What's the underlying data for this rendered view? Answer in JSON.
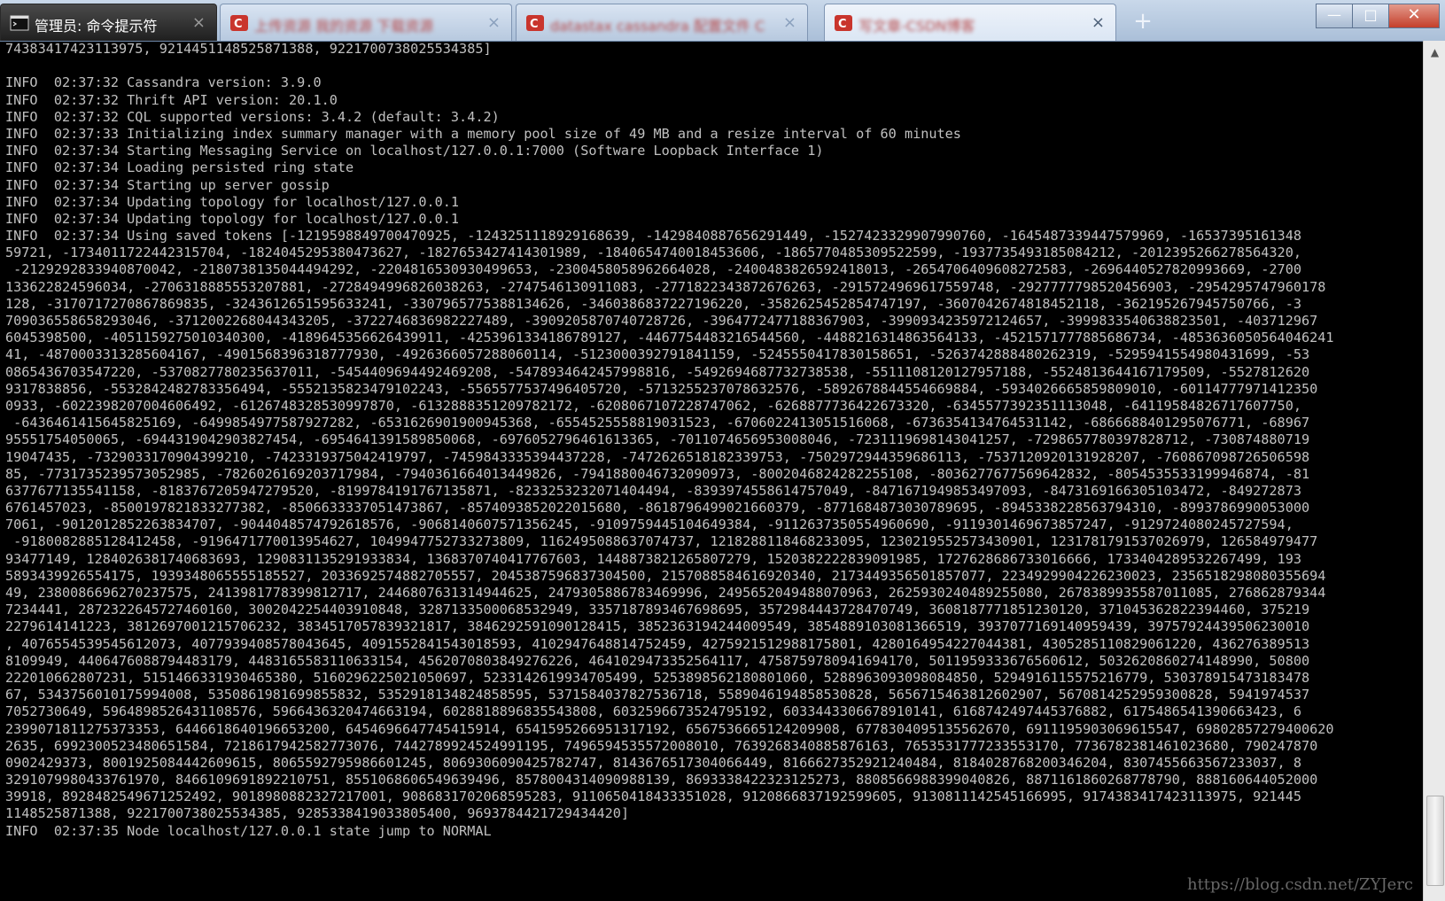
{
  "tabs": [
    {
      "title": "管理员: 命令提示符",
      "close": "×"
    },
    {
      "title": "上传资源 我的资源 下载资源",
      "close": "×"
    },
    {
      "title": "datastax cassandra 配置文件 C",
      "close": "×"
    },
    {
      "title": "写文章-CSDN博客",
      "close": "×"
    }
  ],
  "new_tab": "+",
  "window_buttons": {
    "minimize": "—",
    "maximize": "□",
    "close": "✕"
  },
  "console_lines": [
    "74383417423113975, 9214451148525871388, 9221700738025534385]",
    "",
    "INFO  02:37:32 Cassandra version: 3.9.0",
    "INFO  02:37:32 Thrift API version: 20.1.0",
    "INFO  02:37:32 CQL supported versions: 3.4.2 (default: 3.4.2)",
    "INFO  02:37:33 Initializing index summary manager with a memory pool size of 49 MB and a resize interval of 60 minutes",
    "INFO  02:37:34 Starting Messaging Service on localhost/127.0.0.1:7000 (Software Loopback Interface 1)",
    "INFO  02:37:34 Loading persisted ring state",
    "INFO  02:37:34 Starting up server gossip",
    "INFO  02:37:34 Updating topology for localhost/127.0.0.1",
    "INFO  02:37:34 Updating topology for localhost/127.0.0.1",
    "INFO  02:37:34 Using saved tokens [-1219598849700470925, -1243251118929168639, -1429840887656291449, -1527423329907990760, -1645487339447579969, -16537395161348",
    "59721, -1734011722442315704, -1824045295380473627, -1827653427414301989, -1840654740018453606, -1865770485309522599, -1937735493185084212, -2012395266278564320,",
    " -2129292833940870042, -2180738135044494292, -2204816530930499653, -2300458058962664028, -2400483826592418013, -2654706409608272583, -2696440527820993669, -2700",
    "133622824596034, -2706318885553207881, -2728494996826038263, -2747546130911083, -2771822343872676263, -2915724969617559748, -2927777798520456903, -2954295747960178",
    "128, -3170717270867869835, -3243612651595633241, -3307965775388134626, -3460386837227196220, -3582625452854747197, -3607042674818452118, -362195267945750766, -3",
    "709036558658293046, -3712002268044343205, -3722746836982227489, -3909205870740728726, -3964772477188367903, -3990934235972124657, -3999833540638823501, -403712967",
    "6045398500, -4051159275010340300, -4189645356626439911, -4253961334186789127, -4467754483216544560, -4488216314863564133, -4521571777885686734, -4853636050564046241",
    "41, -4870003313285604167, -4901568396318777930, -4926366057288060114, -5123000392791841159, -5245550417830158651, -5263742888480262319, -5295941554980431699, -53",
    "0865436703547220, -5370827780235637011, -5454409694492469208, -5478934642457998816, -5492694687732738538, -5511108120127957188, -5524813644167179509, -5527812620",
    "9317838856, -5532842482783356494, -5552135823479102243, -5565577537496405720, -5713255237078632576, -5892678844554669884, -5934026665859809010, -60114777971412350",
    "0933, -6022398207004606492, -6126748328530997870, -6132888351209782172, -6208067107228747062, -6268877736422673320, -6345577392351113048, -64119584826717607750,",
    " -6436461415645825169, -6499854977587927282, -6531626901900945368, -6554525558819031523, -6706022413051516068, -6736354134764531142, -6866688401295076771, -68967",
    "95551754050065, -6944319042903827454, -6954641391589850068, -6976052796461613365, -7011074656953008046, -7231119698143041257, -7298657780397828712, -730874880719",
    "19047435, -7329033170904399210, -7423319375042419797, -7459843335394437228, -7472626518182339753, -7502972944359686113, -7537120920131928207, -760867098726506598",
    "85, -7731735239573052985, -7826026169203717984, -7940361664013449826, -7941880046732090973, -8002046824282255108, -8036277677569642832, -8054535533199946874, -81",
    "6377677135541158, -8183767205947279520, -8199784191767135871, -8233253232071404494, -8393974558614757049, -8471671949853497093, -8473169166305103472, -849272873",
    "6761457023, -8500197821833277382, -8506633337051473867, -8574093852022015680, -8618796499021660379, -8771684873030789695, -8945338228563794310, -8993786990053000",
    "7061, -9012012852263834707, -9044048574792618576, -9068140607571356245, -9109759445104649384, -9112637350554960690, -9119301469673857247, -9129724080245727594,",
    " -9180082885128412458, -9196471770013954627, 1049947752733273809, 1162495088637074737, 1218288118468233095, 1230219552573430901, 1231781791537026979, 126584979477",
    "93477149, 1284026381740683693, 1290831135291933834, 1368370740417767603, 1448873821265807279, 1520382222839091985, 1727628686733016666, 1733404289532267499, 193",
    "5893439926554175, 1939348065555185527, 2033692574882705557, 2045387596837304500, 2157088584616920340, 2173449356501857077, 2234929904226230023, 2356518298080355694",
    "49, 2380086696270237575, 2413981778399812717, 2446807631314944625, 2479305886783469996, 2495652049488070963, 2625930240489255080, 2678389935587011085, 276862879344",
    "7234441, 2872322645727460160, 3002042254403910848, 3287133500068532949, 3357187893467698695, 3572984443728470749, 3608187771851230120, 371045362822394460, 375219",
    "2279614141223, 3812697001215706232, 3834517057839321817, 3846292591090128415, 3852363194244009549, 3854889103081366519, 3937077169140959439, 39757924439506230010",
    ", 4076554539545612073, 4077939408578043645, 4091552841543018593, 4102947648814752459, 4275921512988175801, 4280164954227044381, 4305285110829061220, 436276389513",
    "8109949, 4406476088794483179, 4483165583110633154, 4562070803849276226, 4641029473352564117, 4758759780941694170, 5011959333676560612, 5032620860274148990, 50800",
    "222010662807231, 5151466331930465380, 5160296225021050697, 5233142619934705499, 5253898562180801060, 5288963093098084850, 5294916115575216779, 530378915473183478",
    "67, 5343756010175994008, 5350861981699855832, 5352918134824858595, 5371584037827536718, 5589046194858530828, 5656715463812602907, 5670814252959300828, 5941974537",
    "7052730649, 5964898526431108576, 5966436320474663194, 6028818896835543808, 6032596673524795192, 6033443306678910141, 6168742497445376882, 6175486541390663423, 6",
    "2399071811275373353, 6446618640196653200, 6454696647745415914, 6541595266951317192, 6567536665124209908, 6778304095135562670, 6911195903069615547, 69802857279400620",
    "2635, 6992300523480651584, 7218617942582773076, 7442789924524991195, 7496594535572008010, 7639268340885876163, 7653531777233553170, 7736782381461023680, 790247870",
    "0902429373, 8001925084442609615, 8065592795986601245, 8069306090425782747, 8143676517304066449, 8166627352921240484, 8184028768200346204, 8307455663567233037, 8",
    "3291079980433761970, 8466109691892210751, 8551068606549639496, 8578004314090988139, 8693338422323125273, 8808566988399040826, 8871161860268778790, 888160644052000",
    "39918, 8928482549671252492, 9018980882327217001, 9086831702068595283, 9110650418433351028, 9120866837192599605, 9130811142545166995, 9174383417423113975, 921445",
    "1148525871388, 9221700738025534385, 9285338419033805400, 9693784421729434420]",
    "INFO  02:37:35 Node localhost/127.0.0.1 state jump to NORMAL"
  ],
  "watermark": "https://blog.csdn.net/ZYJerc"
}
